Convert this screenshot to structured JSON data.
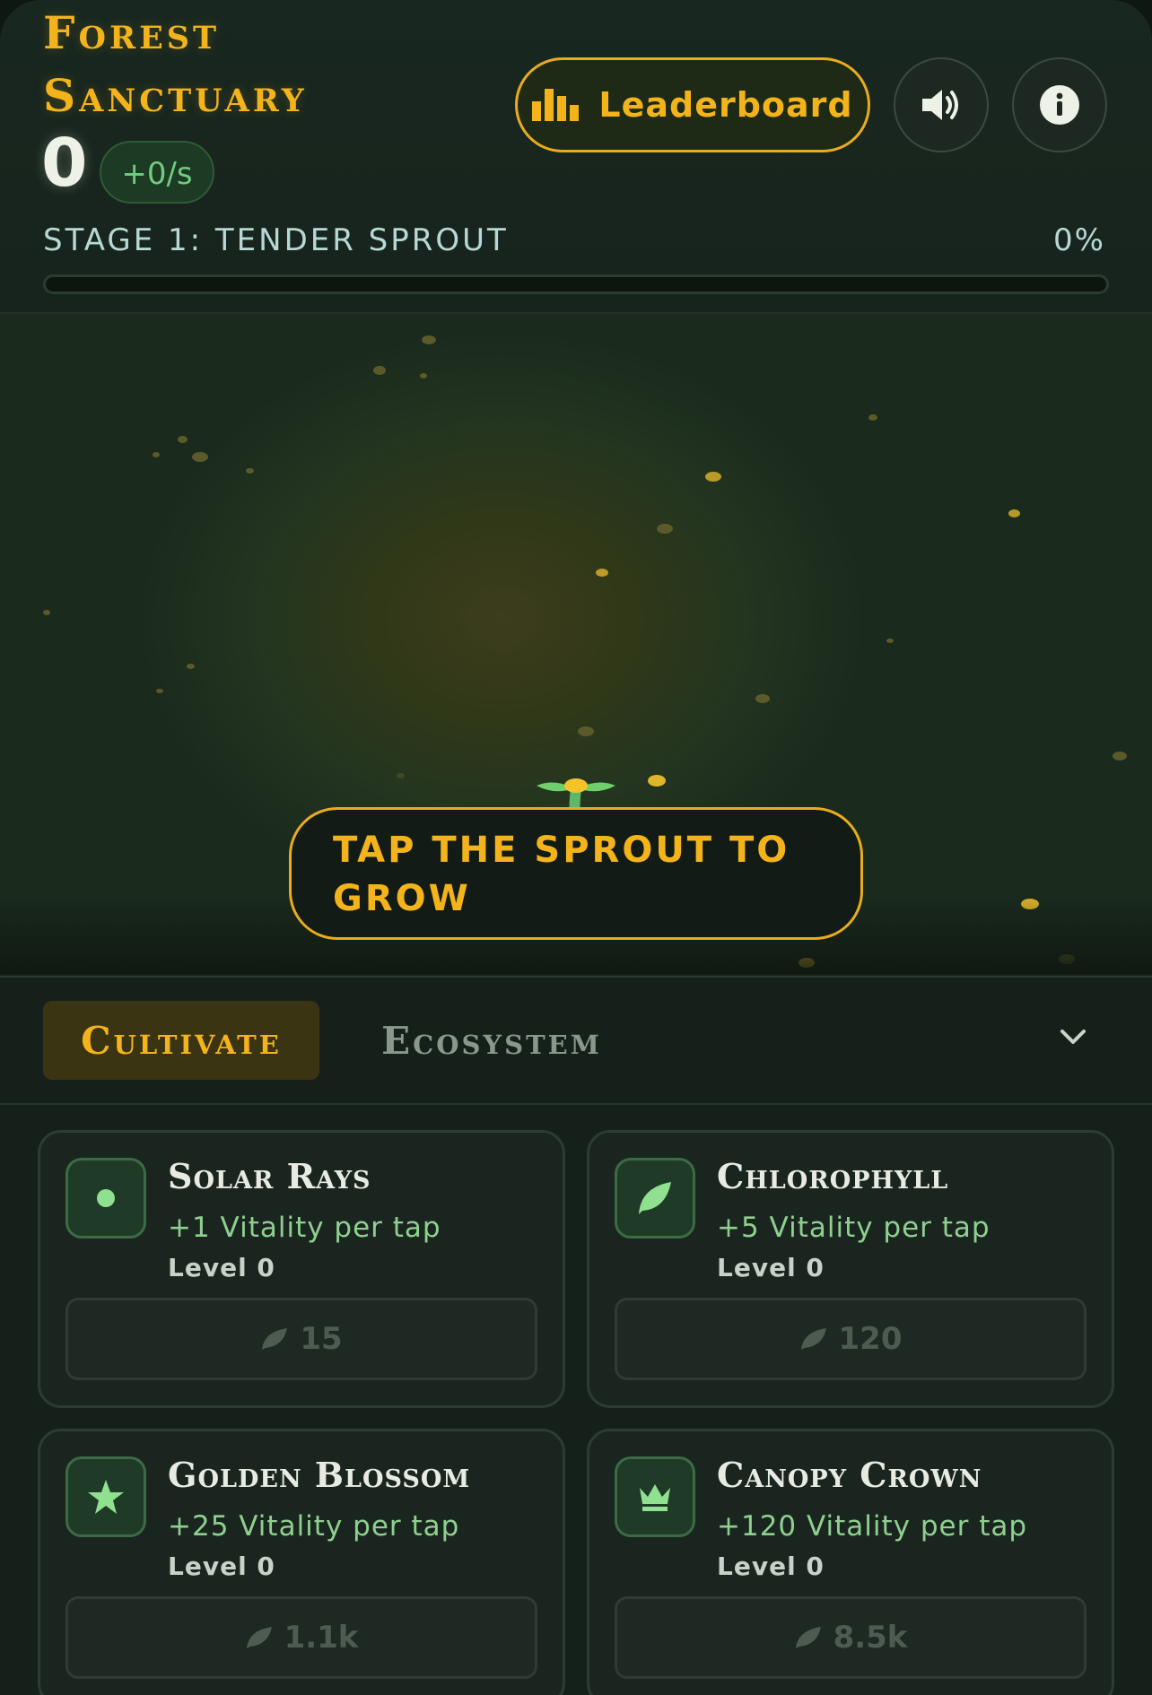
{
  "header": {
    "title": "Forest Sanctuary",
    "score": "0",
    "rate": "+0/s",
    "leaderboard_label": "Leaderboard",
    "sound_icon": "speaker-icon",
    "info_icon": "info-icon",
    "stage_label": "Stage 1: Tender Sprout",
    "progress_text": "0%",
    "progress_fraction": 0
  },
  "garden": {
    "tap_hint": "Tap the sprout to grow"
  },
  "tabs": {
    "items": [
      {
        "label": "Cultivate",
        "active": true
      },
      {
        "label": "Ecosystem",
        "active": false
      }
    ],
    "collapse_icon": "chevron-down-icon"
  },
  "upgrades": [
    {
      "name": "Solar Rays",
      "effect": "+1 Vitality per tap",
      "level": "Level 0",
      "cost": "15",
      "icon": "dot-icon"
    },
    {
      "name": "Chlorophyll",
      "effect": "+5 Vitality per tap",
      "level": "Level 0",
      "cost": "120",
      "icon": "leaf-icon"
    },
    {
      "name": "Golden Blossom",
      "effect": "+25 Vitality per tap",
      "level": "Level 0",
      "cost": "1.1k",
      "icon": "star-icon"
    },
    {
      "name": "Canopy Crown",
      "effect": "+120 Vitality per tap",
      "level": "Level 0",
      "cost": "8.5k",
      "icon": "crown-icon"
    }
  ],
  "colors": {
    "accent": "#f3b41b",
    "background": "#16201a",
    "positive": "#6fcd7d"
  }
}
